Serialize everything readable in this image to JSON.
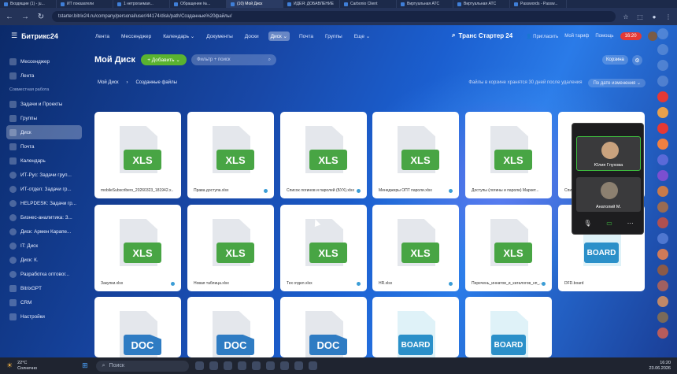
{
  "browser": {
    "tabs": [
      {
        "label": "Входящие (1) - ju..."
      },
      {
        "label": "ИТ показатели"
      },
      {
        "label": "1 нетрогаемая..."
      },
      {
        "label": "Обращение №..."
      },
      {
        "label": "(10) Мой Диск",
        "active": true
      },
      {
        "label": "ИДЕЯ: ДОБАВЛЕНИЕ"
      },
      {
        "label": "Carbonio Client"
      },
      {
        "label": "Виртуальная АТС"
      },
      {
        "label": "Виртуальная АТС"
      },
      {
        "label": "Passwords - Passw..."
      }
    ],
    "url": "tstarter.bitrix24.ru/company/personal/user/44174/disk/path/Созданные%20файлы/"
  },
  "app": {
    "logo": "Битрикс24",
    "topnav": [
      "Лента",
      "Мессенджер",
      "Календарь ⌄",
      "Документы",
      "Доски",
      "Диск ⌄",
      "Почта",
      "Группы",
      "Еще ⌄"
    ],
    "company": "Транс Стартер 24",
    "invite": "Пригласить",
    "my_plan": "Мой тариф",
    "help": "Помощь",
    "clock": "16:20"
  },
  "sidebar": {
    "items": [
      {
        "label": "Мессенджер",
        "icon": "chat-icon"
      },
      {
        "label": "Лента",
        "icon": "feed-icon"
      },
      {
        "label": "Совместная работа",
        "section": true
      },
      {
        "label": "Задачи и Проекты",
        "icon": "tasks-icon"
      },
      {
        "label": "Группы",
        "icon": "groups-icon"
      },
      {
        "label": "Диск",
        "icon": "disk-icon",
        "active": true
      },
      {
        "label": "Почта",
        "icon": "mail-icon"
      },
      {
        "label": "Календарь",
        "icon": "calendar-icon"
      },
      {
        "label": "ИТ-Рус: Задачи груп...",
        "icon": "group-avatar"
      },
      {
        "label": "ИТ-отдел: Задачи гр...",
        "icon": "group-avatar"
      },
      {
        "label": "HELPDESK: Задачи гр...",
        "icon": "group-avatar"
      },
      {
        "label": "Бизнес-аналитика: З...",
        "icon": "group-avatar"
      },
      {
        "label": "Диск: Армен Карапе...",
        "icon": "group-avatar"
      },
      {
        "label": "IT: Диск",
        "icon": "group-avatar"
      },
      {
        "label": "Диск: К.",
        "icon": "group-avatar"
      },
      {
        "label": "Разработка оптовог...",
        "icon": "group-avatar"
      },
      {
        "label": "BitrixGPT",
        "icon": "ai-icon"
      },
      {
        "label": "CRM",
        "icon": "crm-icon"
      },
      {
        "label": "Настройки",
        "icon": "settings-icon"
      }
    ]
  },
  "page": {
    "title": "Мой Диск",
    "add_button": "+ Добавить ⌄",
    "filter_placeholder": "Фильтр + поиск",
    "trash_button": "Корзина",
    "breadcrumb": [
      "Мой Диск",
      "›",
      "Созданные файлы"
    ],
    "trash_info": "Файлы в корзине хранятся 30 дней после удаления",
    "sort": "По дате изменения ⌄"
  },
  "files": [
    {
      "name": "mobileSubscribers_20260323_181942.x...",
      "type": "XLS"
    },
    {
      "name": "Права доступа.xlsx",
      "type": "XLS"
    },
    {
      "name": "Список логинов и паролей (БУХ).xlsx",
      "type": "XLS"
    },
    {
      "name": "Менеджеры ОПТ пароли.xlsx",
      "type": "XLS"
    },
    {
      "name": "Доступы (логины и пароли) Маркет...",
      "type": "XLS"
    },
    {
      "name": "Спис...",
      "type": "XLS"
    },
    {
      "name": "Закупки.xlsx",
      "type": "XLS"
    },
    {
      "name": "Новая таблица.xlsx",
      "type": "XLS"
    },
    {
      "name": "Тех отдел.xlsx",
      "type": "XLS"
    },
    {
      "name": "HR.xlsx",
      "type": "XLS"
    },
    {
      "name": "Перечень_иннатов_и_каталогов_нп_...",
      "type": "XLS"
    },
    {
      "name": "DFD.board",
      "type": "BOARD"
    },
    {
      "name": "",
      "type": "DOC"
    },
    {
      "name": "",
      "type": "DOC"
    },
    {
      "name": "",
      "type": "DOC"
    },
    {
      "name": "",
      "type": "BOARD"
    },
    {
      "name": "",
      "type": "BOARD"
    }
  ],
  "call": {
    "participants": [
      "Юлия Глухова",
      "Анатолий М."
    ]
  },
  "taskbar": {
    "temp": "22°C",
    "weather": "Солнечно",
    "search_placeholder": "Поиск",
    "time": "16:20",
    "date": "23.06.2026"
  }
}
